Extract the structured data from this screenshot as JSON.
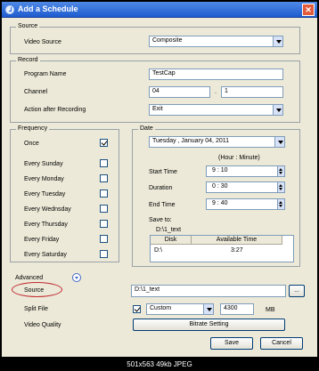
{
  "window": {
    "title": "Add a Schedule"
  },
  "source_group": {
    "title": "Source",
    "video_source_label": "Video Source",
    "video_source_value": "Composite"
  },
  "record_group": {
    "title": "Record",
    "program_name_label": "Program Name",
    "program_name_value": "TestCap",
    "channel_label": "Channel",
    "channel_major": "04",
    "channel_sep": ".",
    "channel_minor": "1",
    "action_label": "Action after Recording",
    "action_value": "Exit"
  },
  "frequency_group": {
    "title": "Frequency",
    "items": [
      {
        "label": "Once",
        "checked": true
      },
      {
        "label": "Every Sunday",
        "checked": false
      },
      {
        "label": "Every Monday",
        "checked": false
      },
      {
        "label": "Every Tuesday",
        "checked": false
      },
      {
        "label": "Every Wednsday",
        "checked": false
      },
      {
        "label": "Every Thursday",
        "checked": false
      },
      {
        "label": "Every Friday",
        "checked": false
      },
      {
        "label": "Every Saturday",
        "checked": false
      }
    ]
  },
  "date_group": {
    "title": "Date",
    "date_value": "Tuesday  ,  January  04, 2011",
    "time_format_hint": "(Hour : Minute)",
    "start_time_label": "Start Time",
    "start_time_value": "9 : 10",
    "duration_label": "Duration",
    "duration_value": "0 : 30",
    "end_time_label": "End Time",
    "end_time_value": "9 : 40",
    "save_to_label": "Save to:",
    "save_to_path": "D:\\1_text",
    "table": {
      "headers": [
        "Disk",
        "Available Time"
      ],
      "rows": [
        [
          "D:\\",
          "3:27"
        ]
      ]
    }
  },
  "advanced": {
    "label": "Advanced",
    "source_label": "Source",
    "source_path": "D:\\1_text",
    "browse_label": "...",
    "split_file_label": "Split File",
    "split_mode": "Custom",
    "split_size": "4300",
    "split_unit": "MB",
    "video_quality_label": "Video Quality",
    "bitrate_button": "Bitrate Setting"
  },
  "buttons": {
    "save": "Save",
    "cancel": "Cancel"
  },
  "footer": {
    "caption": "501x563 49kb JPEG"
  }
}
